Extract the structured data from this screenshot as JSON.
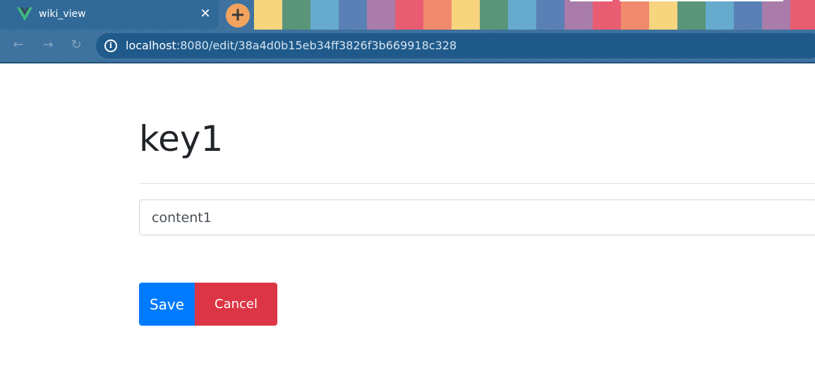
{
  "browser": {
    "tab": {
      "title": "wiki_view",
      "favicon": "vue-logo-icon",
      "close_glyph": "✕"
    },
    "new_tab_glyph": "+",
    "theme_stripe_colors": [
      "#f6d57e",
      "#5a9479",
      "#66aacd",
      "#5a80b5",
      "#a97ca9",
      "#e85d71",
      "#f28b6e",
      "#f6d57e",
      "#5a9479",
      "#66aacd",
      "#5a80b5",
      "#a97ca9",
      "#e85d71",
      "#f28b6e",
      "#f6d57e",
      "#5a9479",
      "#66aacd",
      "#5a80b5",
      "#a97ca9",
      "#e85d71"
    ],
    "nav": {
      "back_glyph": "←",
      "forward_glyph": "→",
      "reload_glyph": "↻"
    },
    "address_bar": {
      "info_glyph": "i",
      "host": "localhost",
      "path": ":8080/edit/38a4d0b15eb34ff3826f3b669918c328"
    }
  },
  "page": {
    "title": "key1",
    "content_field": {
      "value": "content1"
    },
    "buttons": {
      "save_label": "Save",
      "cancel_label": "Cancel"
    }
  },
  "colors": {
    "save": "#007bff",
    "cancel": "#dc3545",
    "vue_green": "#41b883"
  }
}
